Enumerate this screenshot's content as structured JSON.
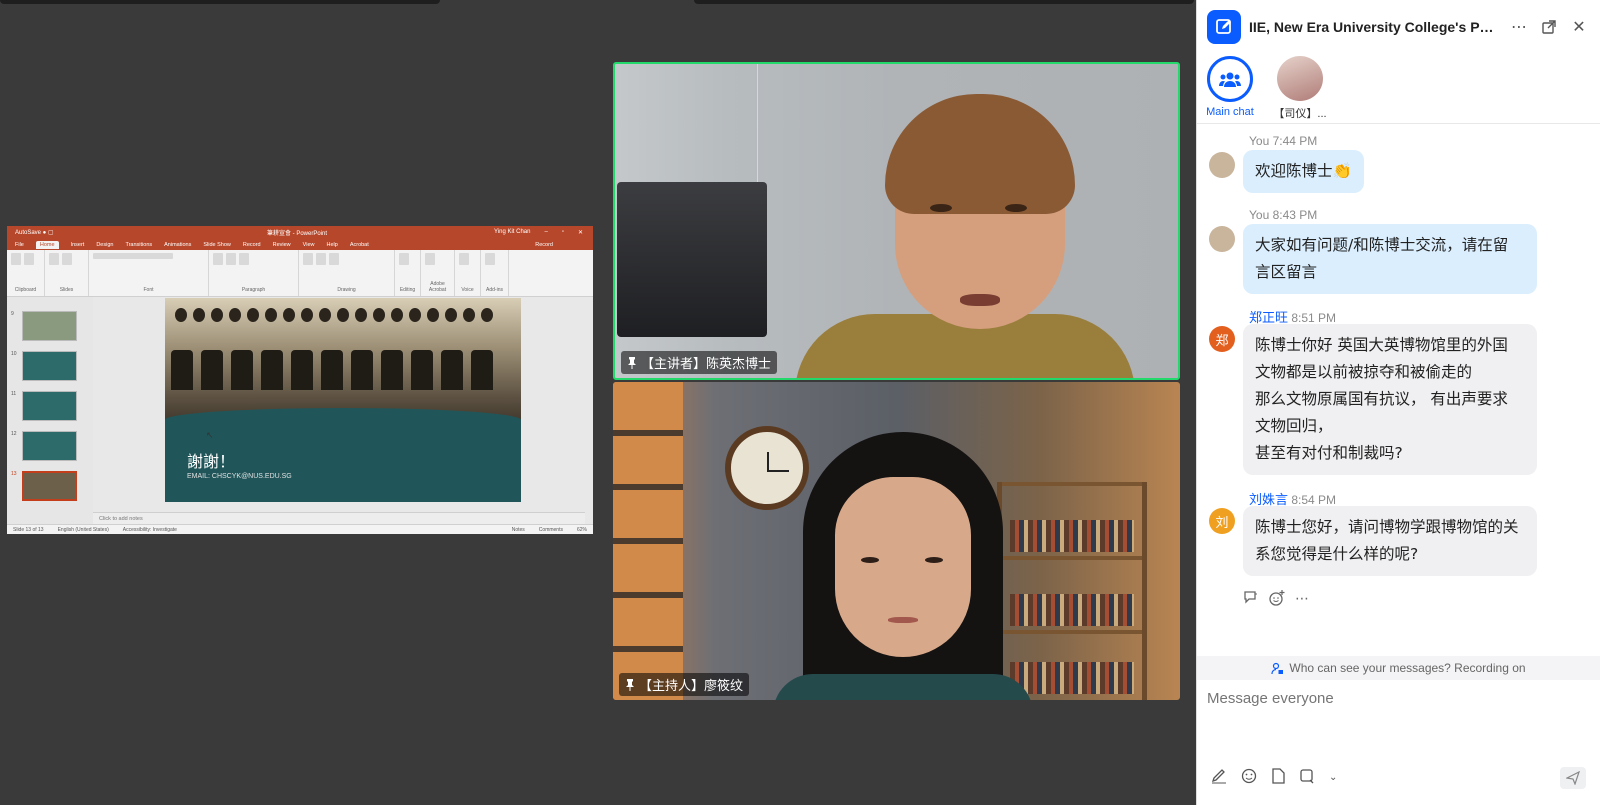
{
  "chat": {
    "title": "IIE, New Era University College's Person...",
    "tabs": [
      {
        "label": "Main chat"
      },
      {
        "label": "【司仪】..."
      }
    ],
    "messages": [
      {
        "sender": "You",
        "time": "7:44 PM",
        "avatar_text": "",
        "text": "欢迎陈博士👏"
      },
      {
        "sender": "You",
        "time": "8:43 PM",
        "avatar_text": "",
        "text": "大家如有问题/和陈博士交流，请在留言区留言"
      },
      {
        "sender": "郑正旺",
        "time": "8:51 PM",
        "avatar_text": "郑",
        "avatar_color": "#e35f1e",
        "text": "陈博士你好 英国大英博物馆里的外国文物都是以前被掠夺和被偷走的 那么文物原属国有抗议， 有出声要求文物回归， 甚至有对付和制裁吗?"
      },
      {
        "sender": "刘姝言",
        "time": "8:54 PM",
        "avatar_text": "刘",
        "avatar_color": "#f0a020",
        "text": "陈博士您好，请问博物学跟博物馆的关系您觉得是什么样的呢?"
      }
    ],
    "message_lines": {
      "m2": [
        "大家如有问题/和陈博士交流，请在留",
        "言区留言"
      ],
      "m3": [
        "陈博士你好 英国大英博物馆里的外国",
        "文物都是以前被掠夺和被偷走的",
        "那么文物原属国有抗议， 有出声要求",
        "文物回归，",
        "甚至有对付和制裁吗?"
      ],
      "m4": [
        "陈博士您好，请问博物学跟博物馆的关",
        "系您觉得是什么样的呢?"
      ]
    },
    "privacy_text": "Who can see your messages? Recording on",
    "input_placeholder": "Message everyone"
  },
  "tiles": [
    {
      "label": "【主讲者】陈英杰博士",
      "active_speaker": true
    },
    {
      "label": "【主持人】廖筱纹",
      "active_speaker": false
    }
  ],
  "shared_screen": {
    "app_title": "筆耕宣會 - PowerPoint",
    "user_name": "Ying Kit Chan",
    "ribbon_tabs": [
      "File",
      "Home",
      "Insert",
      "Design",
      "Transitions",
      "Animations",
      "Slide Show",
      "Record",
      "Review",
      "View",
      "Help",
      "Acrobat"
    ],
    "ribbon_groups": [
      "Clipboard",
      "Slides",
      "Font",
      "Paragraph",
      "Drawing",
      "Editing",
      "Adobe Acrobat",
      "Voice",
      "Add-ins"
    ],
    "record_label": "Record",
    "slide_numbers": [
      "9",
      "10",
      "11",
      "12",
      "13"
    ],
    "slide_title": "謝謝！",
    "slide_email": "EMAIL: CHSCYK@NUS.EDU.SG",
    "notes_placeholder": "Click to add notes",
    "status_slide": "Slide 13 of 13",
    "status_lang": "English (United States)",
    "status_access": "Accessibility: Investigate",
    "status_notes": "Notes",
    "status_comments": "Comments",
    "status_zoom": "62%"
  },
  "colors": {
    "accent": "#0b5cff",
    "active_speaker_border": "#23d96b",
    "ppt_red": "#b7472a"
  }
}
